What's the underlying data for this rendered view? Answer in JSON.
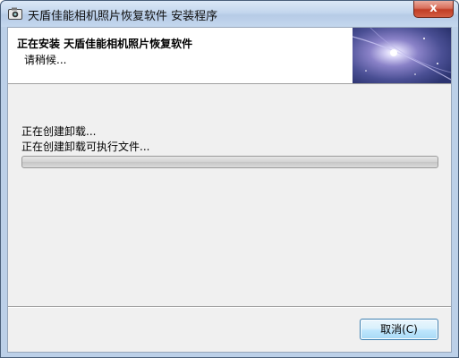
{
  "window": {
    "title": "天盾佳能相机照片恢复软件 安装程序",
    "close_glyph": "x"
  },
  "header": {
    "title": "正在安装 天盾佳能相机照片恢复软件",
    "subtitle": "请稍候..."
  },
  "status": {
    "lines": [
      "正在创建卸载...",
      "正在创建卸载可执行文件..."
    ]
  },
  "progress": {
    "fraction": 0.0
  },
  "buttons": {
    "cancel_label": "取消(C)"
  },
  "icons": {
    "app": "installer-icon",
    "header": "nebula-banner"
  },
  "colors": {
    "client_bg": "#f0f0f0",
    "header_bg": "#ffffff",
    "close_red": "#c03d25",
    "button_border": "#3c7fb1"
  }
}
